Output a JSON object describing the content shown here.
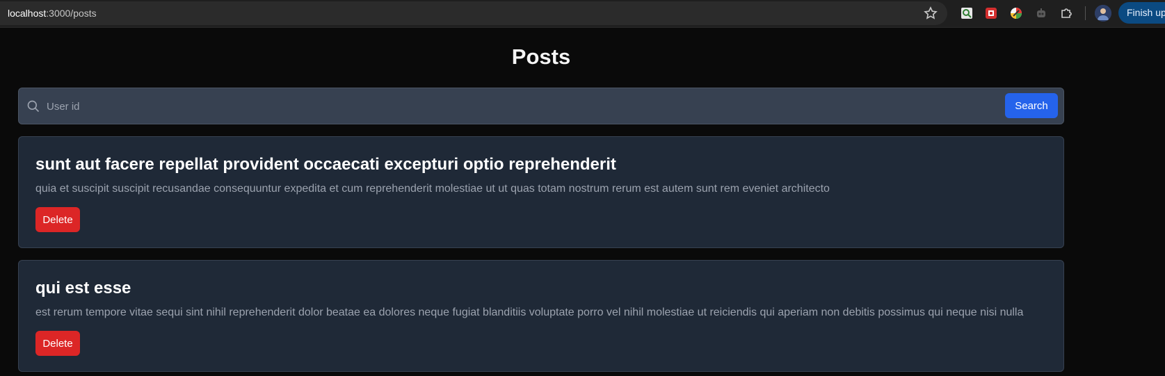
{
  "browser": {
    "url_host": "localhost",
    "url_path": ":3000/posts",
    "finish_button_label": "Finish up",
    "icons": [
      "star-icon",
      "magnifier-extension-icon",
      "red-extension-icon",
      "colorful-extension-icon",
      "robot-extension-icon",
      "puzzle-extensions-icon",
      "profile-avatar"
    ]
  },
  "page": {
    "title": "Posts"
  },
  "search": {
    "placeholder": "User id",
    "button_label": "Search"
  },
  "posts": [
    {
      "title": "sunt aut facere repellat provident occaecati excepturi optio reprehenderit",
      "body": "quia et suscipit suscipit recusandae consequuntur expedita et cum reprehenderit molestiae ut ut quas totam nostrum rerum est autem sunt rem eveniet architecto",
      "delete_label": "Delete"
    },
    {
      "title": "qui est esse",
      "body": "est rerum tempore vitae sequi sint nihil reprehenderit dolor beatae ea dolores neque fugiat blanditiis voluptate porro vel nihil molestiae ut reiciendis qui aperiam non debitis possimus qui neque nisi nulla",
      "delete_label": "Delete"
    }
  ],
  "colors": {
    "page_bg": "#0a0a0a",
    "card_bg": "#1f2937",
    "search_bg": "#374151",
    "primary": "#2563eb",
    "danger": "#dc2626"
  }
}
